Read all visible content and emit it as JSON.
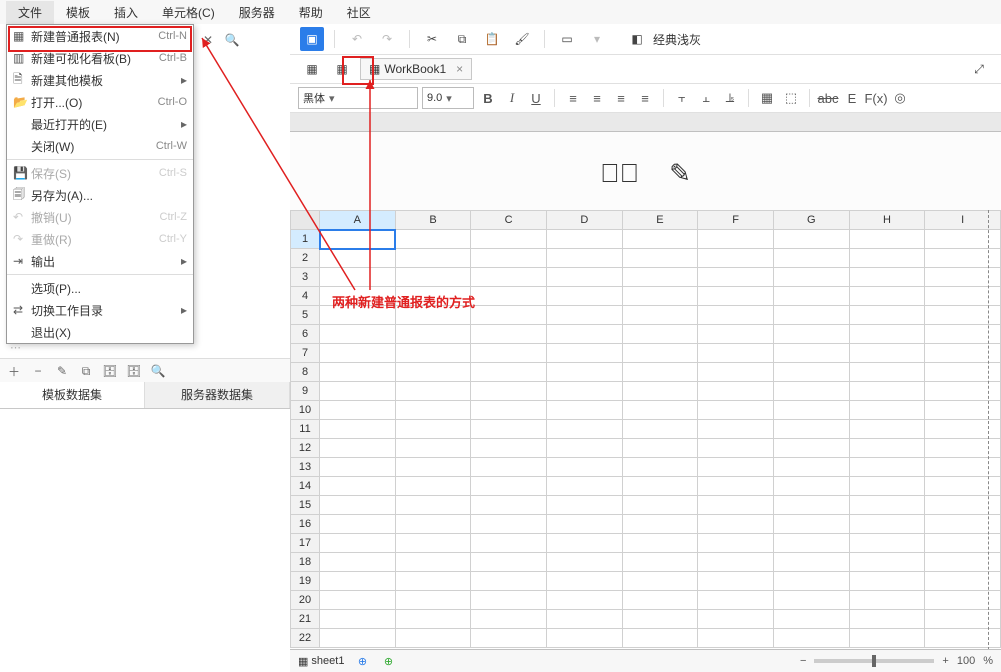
{
  "menubar": {
    "file": "文件",
    "template": "模板",
    "insert": "插入",
    "cell": "单元格(C)",
    "server": "服务器",
    "help": "帮助",
    "community": "社区"
  },
  "file_menu": {
    "new_normal": {
      "label": "新建普通报表(N)",
      "shortcut": "Ctrl-N"
    },
    "new_viz": {
      "label": "新建可视化看板(B)",
      "shortcut": "Ctrl-B"
    },
    "new_other": {
      "label": "新建其他模板"
    },
    "open": {
      "label": "打开...(O)",
      "shortcut": "Ctrl-O"
    },
    "recent": {
      "label": "最近打开的(E)"
    },
    "close": {
      "label": "关闭(W)",
      "shortcut": "Ctrl-W"
    },
    "save": {
      "label": "保存(S)",
      "shortcut": "Ctrl-S"
    },
    "save_as": {
      "label": "另存为(A)..."
    },
    "undo": {
      "label": "撤销(U)",
      "shortcut": "Ctrl-Z"
    },
    "redo": {
      "label": "重做(R)",
      "shortcut": "Ctrl-Y"
    },
    "output": {
      "label": "输出"
    },
    "options": {
      "label": "选项(P)..."
    },
    "switch_wd": {
      "label": "切换工作目录"
    },
    "exit": {
      "label": "退出(X)"
    }
  },
  "dataset_tabs": {
    "template": "模板数据集",
    "server": "服务器数据集"
  },
  "theme": "经典浅灰",
  "workbook_tab": "WorkBook1",
  "font": {
    "family": "黑体",
    "size": "9.0"
  },
  "fmt_labels": {
    "B": "B",
    "I": "I",
    "U": "U",
    "abc": "abc",
    "E": "E",
    "Fx": "F(x)"
  },
  "columns": [
    "A",
    "B",
    "C",
    "D",
    "E",
    "F",
    "G",
    "H",
    "I"
  ],
  "rows": [
    "1",
    "2",
    "3",
    "4",
    "5",
    "6",
    "7",
    "8",
    "9",
    "10",
    "11",
    "12",
    "13",
    "14",
    "15",
    "16",
    "17",
    "18",
    "19",
    "20",
    "21",
    "22"
  ],
  "sheet_tab": "sheet1",
  "zoom": {
    "value": "100",
    "pct": "%",
    "minus": "−",
    "plus": "+"
  },
  "annotation": "两种新建普通报表的方式"
}
